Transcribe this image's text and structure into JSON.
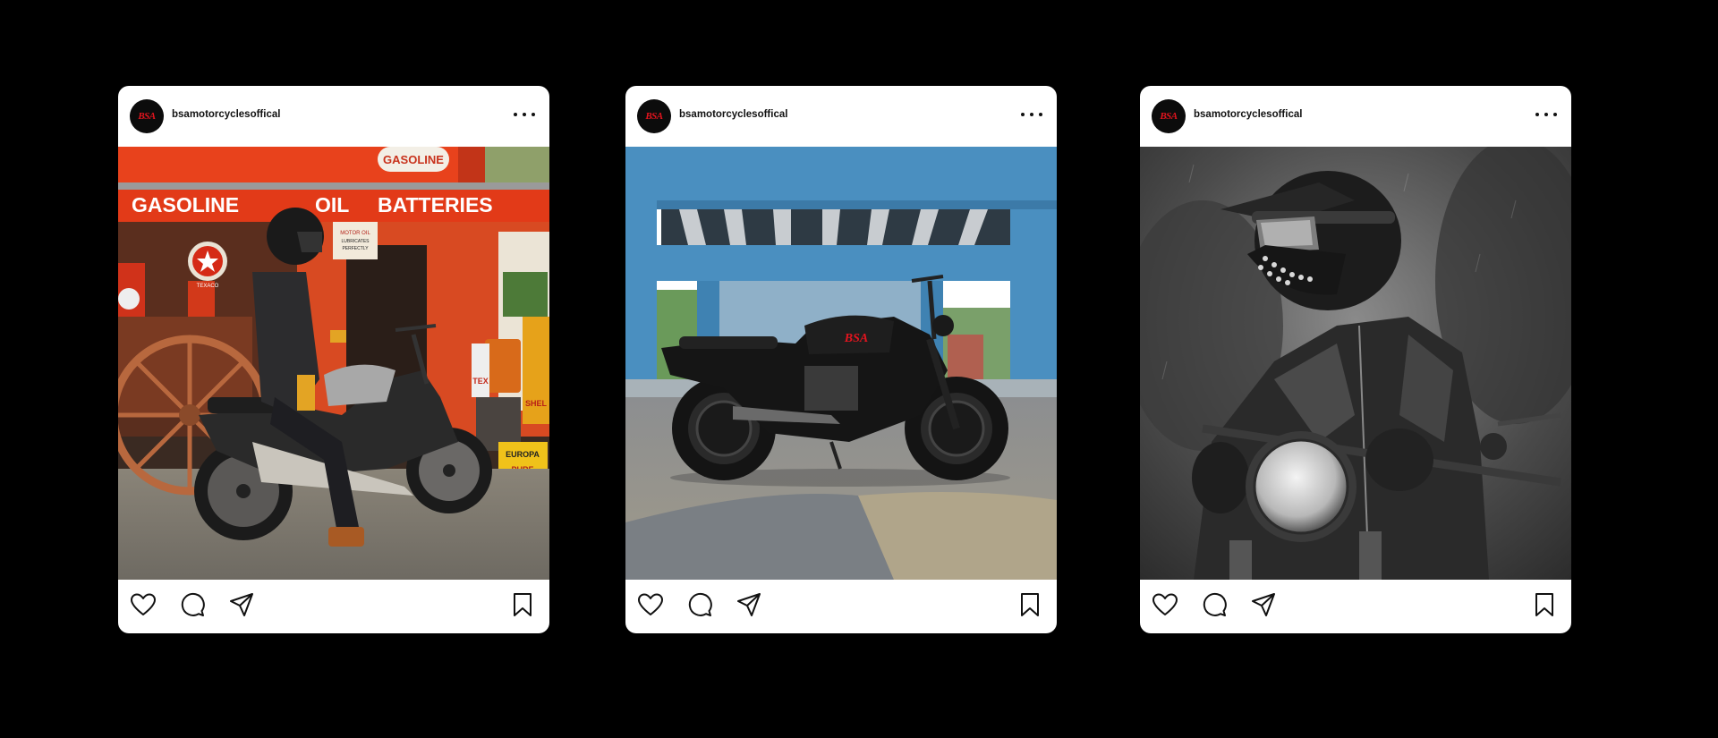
{
  "posts": [
    {
      "avatar": {
        "logo_text": "BSA",
        "logo_color": "#e3141e"
      },
      "username": "bsamotorcyclesoffical",
      "image": {
        "signage": {
          "gasoline": "GASOLINE",
          "oil": "OIL",
          "batteries": "BATTERIES",
          "europa": "EUROPA",
          "pure": "PURE",
          "top_sign": "GASOLINE",
          "motor_oil": "MOTOR OIL",
          "lubricates": "LUBRICATES",
          "perfectly": "PERFECTLY",
          "texaco": "TEXACO",
          "shell": "SHEL",
          "tex": "TEX"
        }
      },
      "icons": [
        "heart-icon",
        "comment-icon",
        "send-icon",
        "bookmark-icon"
      ]
    },
    {
      "avatar": {
        "logo_text": "BSA",
        "logo_color": "#e3141e"
      },
      "username": "bsamotorcyclesoffical",
      "image": {
        "tank_logo": "BSA"
      },
      "icons": [
        "heart-icon",
        "comment-icon",
        "send-icon",
        "bookmark-icon"
      ]
    },
    {
      "avatar": {
        "logo_text": "BSA",
        "logo_color": "#e3141e"
      },
      "username": "bsamotorcyclesoffical",
      "image": {},
      "icons": [
        "heart-icon",
        "comment-icon",
        "send-icon",
        "bookmark-icon"
      ]
    }
  ],
  "colors": {
    "background": "#000000",
    "card": "#ffffff",
    "brand_red": "#e3141e",
    "gas_station_orange": "#e8421c",
    "bridge_blue": "#4a8fc0"
  }
}
